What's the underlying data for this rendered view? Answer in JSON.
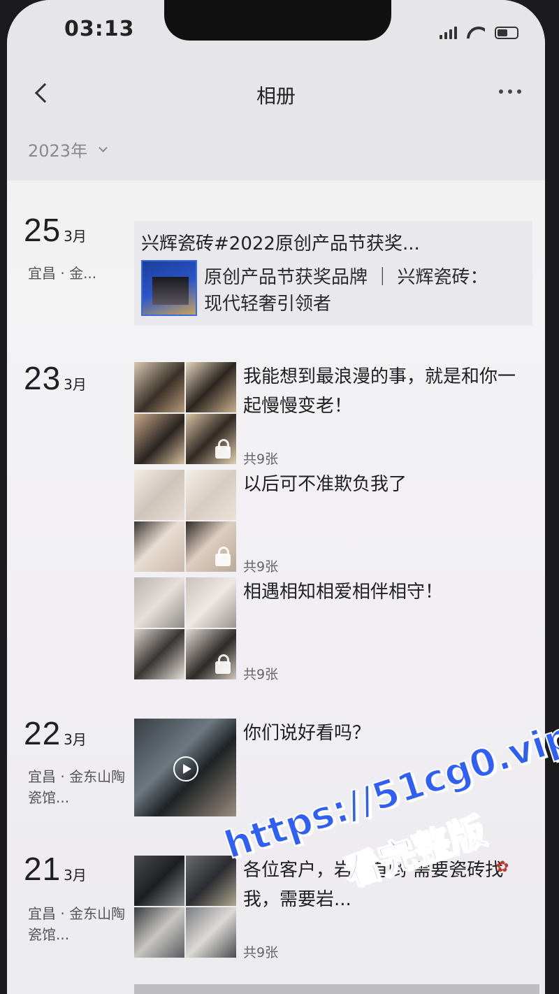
{
  "status_bar": {
    "time": "03:13"
  },
  "nav": {
    "title": "相册"
  },
  "filter": {
    "year": "2023年"
  },
  "entries": [
    {
      "day": "25",
      "month": "3月",
      "location": "宜昌 · 金...",
      "shared": {
        "title": "兴辉瓷砖#2022原创产品节获奖...",
        "text": "原创产品节获奖品牌 ｜ 兴辉瓷砖：现代轻奢引领者"
      }
    },
    {
      "day": "23",
      "month": "3月",
      "posts": [
        {
          "caption": "我能想到最浪漫的事，就是和你一起慢慢变老！",
          "count": "共9张"
        },
        {
          "caption": "以后可不准欺负我了",
          "count": "共9张"
        },
        {
          "caption": "相遇相知相爱相伴相守！",
          "count": "共9张"
        }
      ]
    },
    {
      "day": "22",
      "month": "3月",
      "location": "宜昌 · 金东山陶瓷馆...",
      "posts": [
        {
          "caption": "你们说好看吗？"
        }
      ]
    },
    {
      "day": "21",
      "month": "3月",
      "location": "宜昌 · 金东山陶瓷馆...",
      "posts": [
        {
          "caption": "各位客户，岩板有哟 需要瓷砖找我，需要岩...",
          "count": "共9张"
        }
      ]
    }
  ],
  "watermark": {
    "url": "https://51cg0.vip",
    "sub": "看完整版"
  },
  "colors": {
    "watermark": "#2f5ff5",
    "background": "#f1f0f3"
  }
}
